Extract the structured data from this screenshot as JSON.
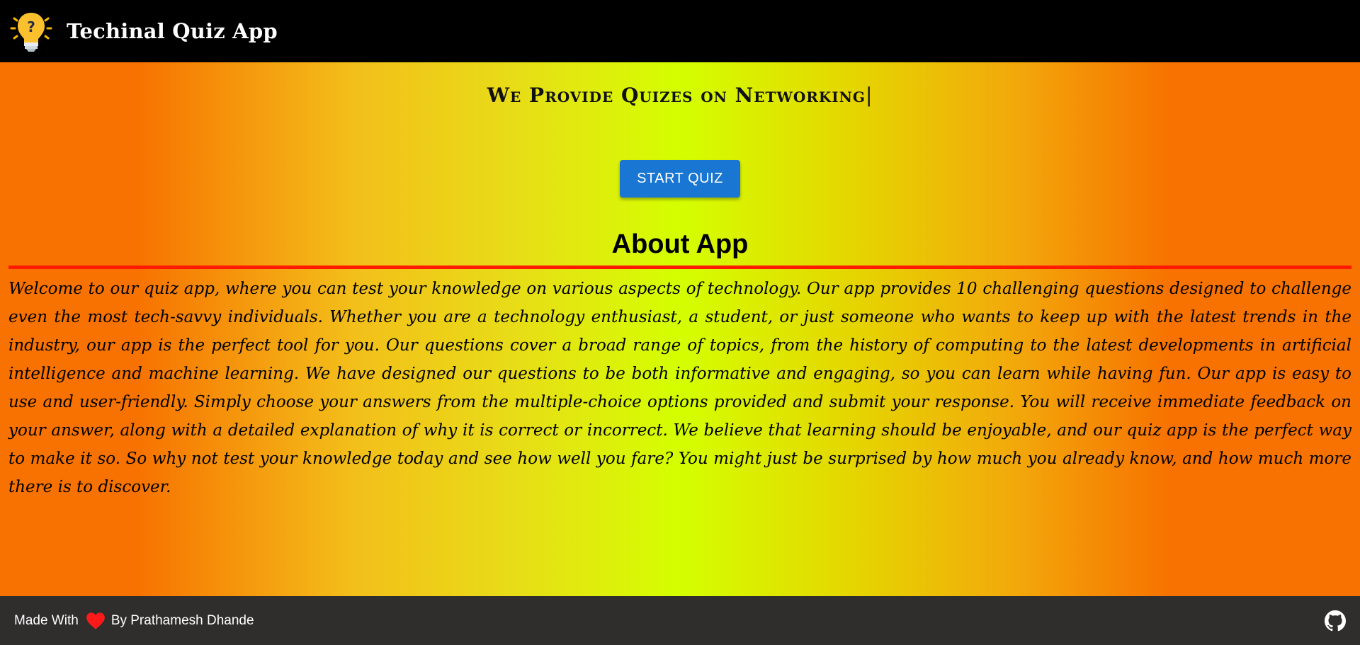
{
  "navbar": {
    "logo_icon": "lightbulb-question-icon",
    "title": "Techinal Quiz App"
  },
  "main": {
    "headline": "We Provide Quizes on Networking",
    "cursor": "|",
    "start_button_label": "START QUIZ",
    "about_title": "About App",
    "about_text": "Welcome to our quiz app, where you can test your knowledge on various aspects of technology. Our app provides 10 challenging questions designed to challenge even the most tech-savvy individuals. Whether you are a technology enthusiast, a student, or just someone who wants to keep up with the latest trends in the industry, our app is the perfect tool for you. Our questions cover a broad range of topics, from the history of computing to the latest developments in artificial intelligence and machine learning. We have designed our questions to be both informative and engaging, so you can learn while having fun. Our app is easy to use and user-friendly. Simply choose your answers from the multiple-choice options provided and submit your response. You will receive immediate feedback on your answer, along with a detailed explanation of why it is correct or incorrect. We believe that learning should be enjoyable, and our quiz app is the perfect way to make it so. So why not test your knowledge today and see how well you fare? You might just be surprised by how much you already know, and how much more there is to discover."
  },
  "footer": {
    "made_with": "Made With",
    "heart_icon": "heart-icon",
    "by_text": "By Prathamesh Dhande",
    "github_icon": "github-icon"
  },
  "colors": {
    "navbar_bg": "#000000",
    "footer_bg": "#302d2d",
    "button_bg": "#1976d2",
    "divider": "#ff1a00",
    "gradient_edge": "#f77200",
    "gradient_center": "#d4ff00"
  }
}
